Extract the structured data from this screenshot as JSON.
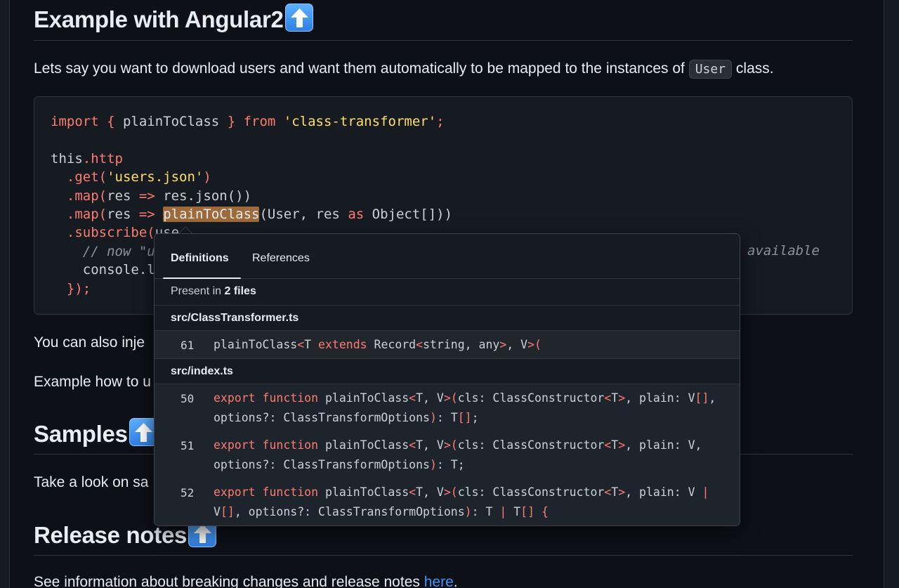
{
  "sections": {
    "angular_title": "Example with Angular2",
    "samples_title": "Samples",
    "release_title": "Release notes"
  },
  "paragraphs": {
    "intro_before": "Lets say you want to download users and want them automatically to be mapped to the instances of ",
    "intro_code": "User",
    "intro_after": " class.",
    "inject": "You can also inje",
    "example_how": "Example how to u",
    "take_look": "Take a look on sa",
    "see_info": "See information about breaking changes and release notes ",
    "see_info_link": "here",
    "see_info_end": "."
  },
  "code": {
    "l1_import": "import",
    "l1_brace_open": " { ",
    "l1_name": "plainToClass",
    "l1_brace_close": " } ",
    "l1_from": "from",
    "l1_module": "'class-transformer'",
    "l1_semi": ";",
    "l3_this": "this",
    "l3_http": ".http",
    "l4_get": ".get(",
    "l4_str": "'users.json'",
    "l4_close": ")",
    "l5_map": ".map(",
    "l5_res": "res ",
    "l5_arrow": "=>",
    "l5_body": " res.json())",
    "l6_map": ".map(",
    "l6_res": "res ",
    "l6_arrow": "=>",
    "l6_space": " ",
    "l6_fn": "plainToClass",
    "l6_args": "(User, res ",
    "l6_as": "as",
    "l6_obj": " Object[]))",
    "l7_subscribe": ".subscribe(",
    "l7_users": "use",
    "l7_tail": "",
    "l8_comment": "// now \"u",
    "l8_available": "available",
    "l9_console": "console.l",
    "l10_close": "});"
  },
  "popup": {
    "tab_definitions": "Definitions",
    "tab_references": "References",
    "present_prefix": "Present in ",
    "present_count": "2 files",
    "files": [
      {
        "path": "src/ClassTransformer.ts",
        "lines": [
          {
            "num": "61",
            "text": "plainToClass<T extends Record<string, any>, V>("
          }
        ]
      },
      {
        "path": "src/index.ts",
        "lines": [
          {
            "num": "50",
            "text": "export function plainToClass<T, V>(cls: ClassConstructor<T>, plain: V[],\noptions?: ClassTransformOptions): T[];"
          },
          {
            "num": "51",
            "text": "export function plainToClass<T, V>(cls: ClassConstructor<T>, plain: V,\noptions?: ClassTransformOptions): T;"
          },
          {
            "num": "52",
            "text": "export function plainToClass<T, V>(cls: ClassConstructor<T>, plain: V |\nV[], options?: ClassTransformOptions): T | T[] {"
          }
        ]
      }
    ]
  },
  "colors": {
    "keyword": "#ff7b72",
    "string": "#ffdf6b",
    "highlight": "#9e6a3a",
    "link": "#4493f8"
  }
}
